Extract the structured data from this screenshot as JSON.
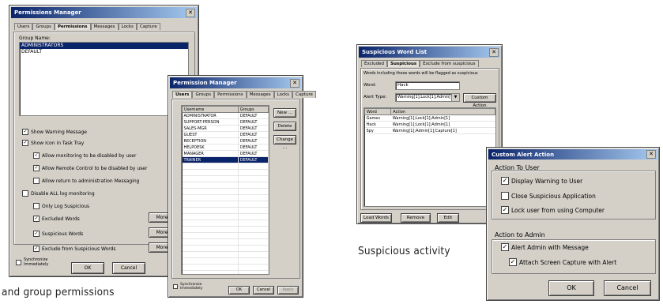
{
  "permissions_manager": {
    "title": "Permissions Manager",
    "tabs": [
      "Users",
      "Groups",
      "Permissions",
      "Messages",
      "Locks",
      "Capture"
    ],
    "active_tab": 2,
    "group_name_label": "Group Name:",
    "groups": [
      "ADMINISTRATORS",
      "DEFAULT"
    ],
    "checkboxes": [
      {
        "label": "Show Warning Message",
        "checked": true
      },
      {
        "label": "Show Icon in Task Tray",
        "checked": true
      },
      {
        "label": "Allow monitoring to be disabled by user",
        "checked": true
      },
      {
        "label": "Allow Remote Control to be disabled by user",
        "checked": true
      },
      {
        "label": "Allow return to administration Messaging",
        "checked": false
      },
      {
        "label": "Disable ALL log monitoring",
        "checked": false
      },
      {
        "label": "Only Log Suspicious",
        "checked": false
      },
      {
        "label": "Excluded Words",
        "checked": true
      },
      {
        "label": "Suspicious Words",
        "checked": true
      },
      {
        "label": "Exclude from Suspicious Words",
        "checked": true
      }
    ],
    "more_label": "More",
    "sync_label": "Synchronize Immediately",
    "ok_label": "OK",
    "cancel_label": "Cancel"
  },
  "users_manager": {
    "title": "Permission Manager",
    "tabs": [
      "Users",
      "Groups",
      "Permissions",
      "Messages",
      "Locks",
      "Capture"
    ],
    "active_tab": 0,
    "columns": [
      "Username",
      "Groups"
    ],
    "rows": [
      [
        "ADMINISTRATOR",
        "DEFAULT"
      ],
      [
        "SUPPORT-PERSON",
        "DEFAULT"
      ],
      [
        "SALES-MGR",
        "DEFAULT"
      ],
      [
        "GUEST",
        "DEFAULT"
      ],
      [
        "RECEPTION",
        "DEFAULT"
      ],
      [
        "HELPDESK",
        "DEFAULT"
      ],
      [
        "MANAGER",
        "DEFAULT"
      ],
      [
        "TRAINER",
        "DEFAULT"
      ]
    ],
    "selected_row": 7,
    "new_label": "New ...",
    "delete_label": "Delete",
    "change_label": "Change ...",
    "sync_label": "Synchronize Immediately",
    "ok_label": "OK",
    "cancel_label": "Cancel",
    "apply_label": "Apply"
  },
  "suspicious_words": {
    "title": "Suspicious Word List",
    "tabs": [
      "Excluded",
      "Suspicious",
      "Exclude from suspicious"
    ],
    "active_tab": 1,
    "info_text": "Words including these words will be flagged as suspicious",
    "word_label": "Word:",
    "word_value": "Hack",
    "alert_label": "Alert Type:",
    "alert_value": "Warning[1];Lock[1];Admin[1]",
    "custom_button": "Custom Action",
    "columns": [
      "Word",
      "Action"
    ],
    "rows": [
      [
        "Games",
        "Warning[1];Lock[1];Admin[1]"
      ],
      [
        "Hack",
        "Warning[1];Lock[1];Admin[1]"
      ],
      [
        "Spy",
        "Warning[1];Admin[1];Capture[1]"
      ]
    ],
    "buttons": [
      "Load Words",
      "Remove",
      "Edit"
    ]
  },
  "custom_alert": {
    "title": "Custom Alert Action",
    "user_section": "Action To User",
    "user_options": [
      {
        "label": "Display Warning to User",
        "checked": true
      },
      {
        "label": "Close Suspicious Application",
        "checked": false
      },
      {
        "label": "Lock user from using Computer",
        "checked": true
      }
    ],
    "admin_section": "Action to Admin",
    "admin_options": [
      {
        "label": "Alert Admin with Message",
        "checked": true
      },
      {
        "label": "Attach Screen Capture with Alert",
        "checked": true
      }
    ],
    "ok_label": "OK",
    "cancel_label": "Cancel"
  },
  "captions": {
    "left": "and group permissions",
    "right": "Suspicious activity"
  }
}
